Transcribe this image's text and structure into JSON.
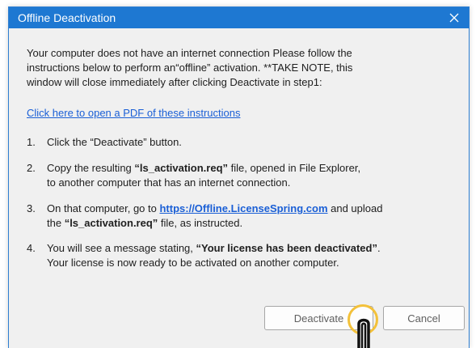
{
  "dialog": {
    "title": "Offline Deactivation",
    "intro_lines": [
      "Your computer does not have an internet connection Please follow the",
      "instructions below to perform an“offline” activation. **TAKE NOTE, this",
      "window will close immediately after clicking Deactivate in step1:"
    ],
    "pdf_link": "Click here to open a PDF of these instructions",
    "steps": [
      {
        "num": "1.",
        "line1": "Click the “Deactivate” button."
      },
      {
        "num": "2.",
        "pre": "Copy the resulting ",
        "bold": "“ls_activation.req”",
        "post": " file, opened in File Explorer,",
        "line2": "to another computer that has an internet connection."
      },
      {
        "num": "3.",
        "pre": "On that computer, go to ",
        "url": "https://Offline.LicenseSpring.com",
        "post": " and upload",
        "line2_pre": "the ",
        "line2_bold": "“ls_activation.req”",
        "line2_post": " file, as instructed."
      },
      {
        "num": "4.",
        "pre": "You will see a message stating, ",
        "bold": "“Your license has been deactivated”",
        "post": ".",
        "line2": "Your license is now ready to be activated on another computer."
      }
    ],
    "buttons": {
      "deactivate": "Deactivate",
      "cancel": "Cancel"
    }
  },
  "colors": {
    "titlebar": "#1e78d2",
    "link": "#1a5fd6",
    "cursor_highlight": "#f3c13a"
  },
  "icons": {
    "close": "close-icon",
    "cursor": "hand-pointer-icon"
  }
}
